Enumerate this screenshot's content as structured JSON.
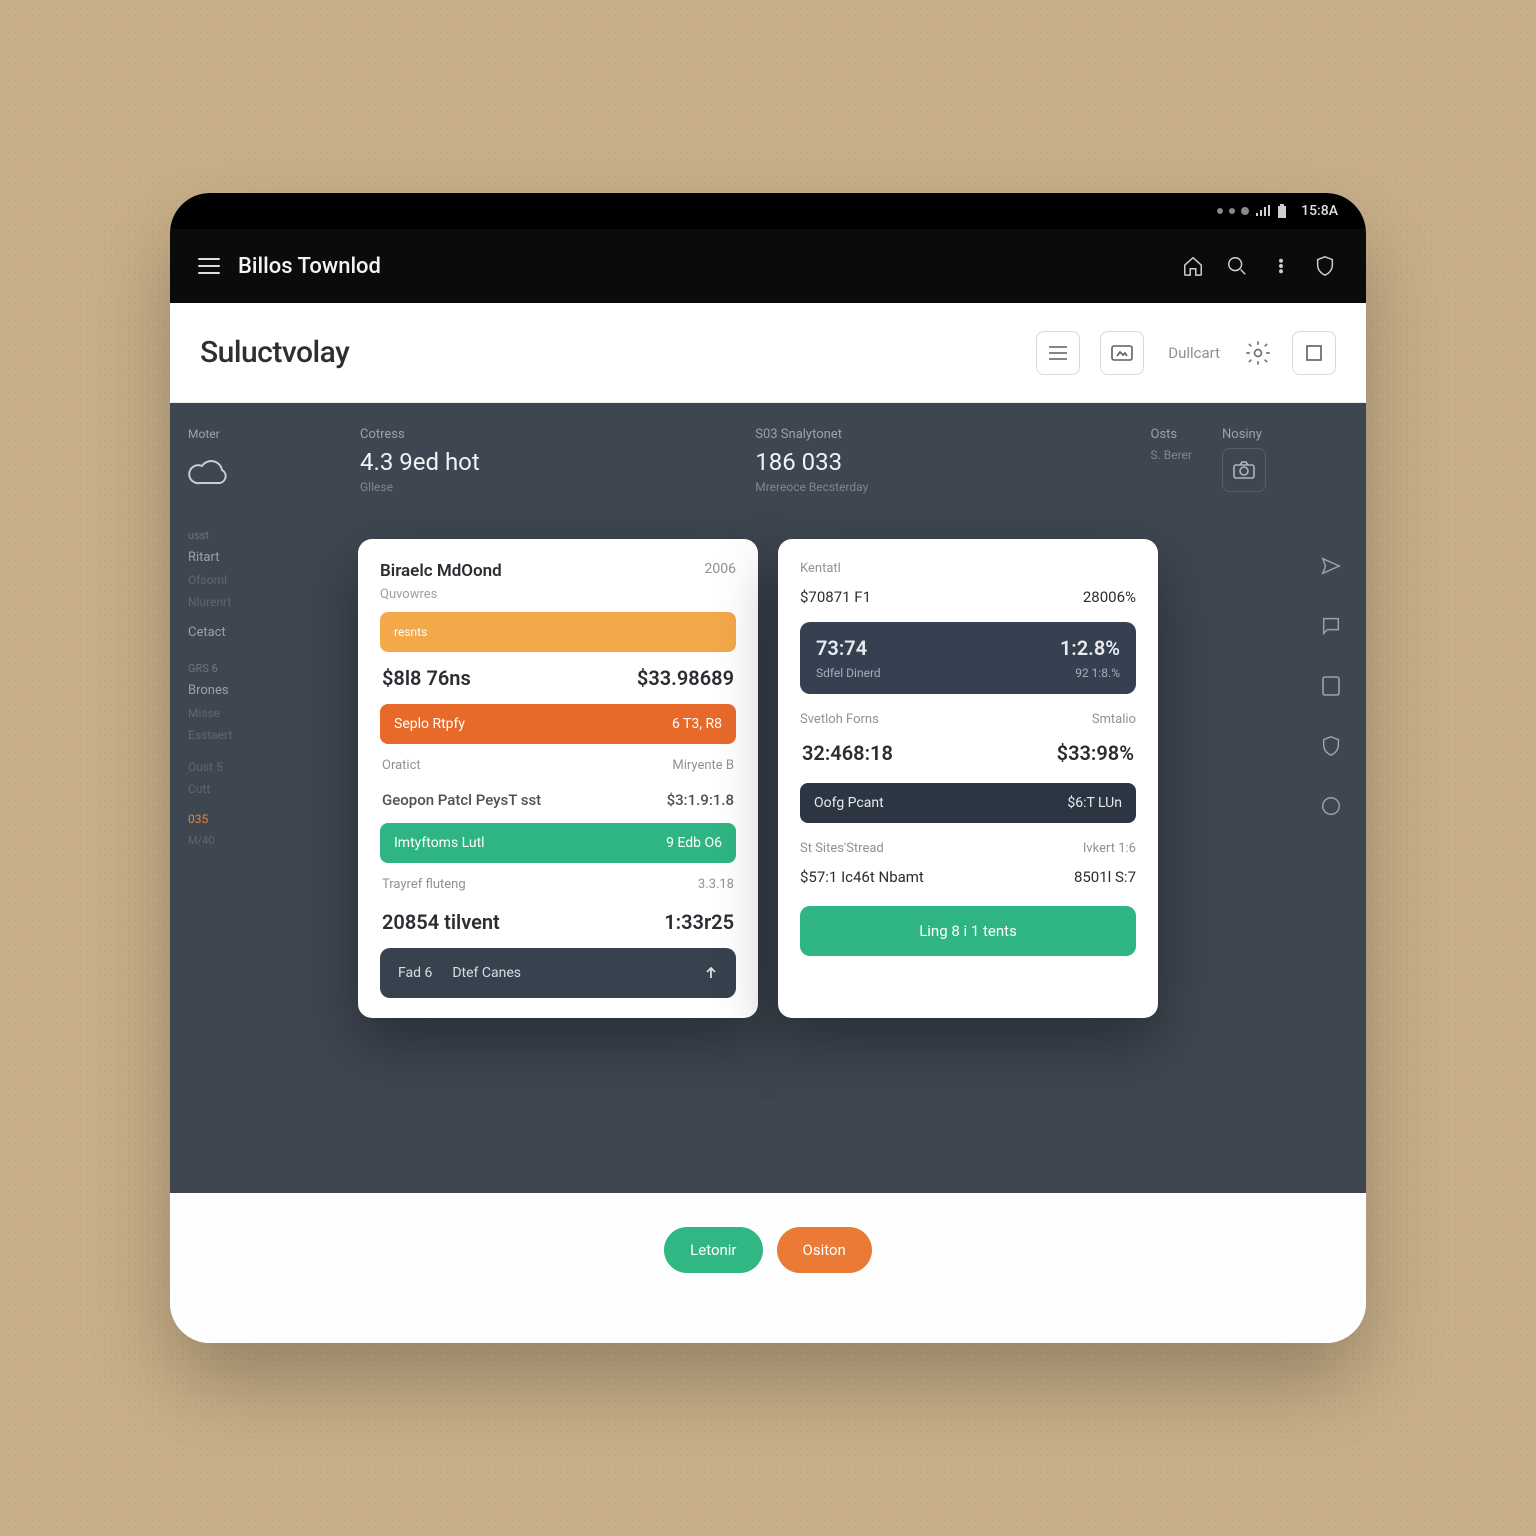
{
  "statusbar": {
    "time": "15:8A"
  },
  "topbar": {
    "title": "Billos Townlod"
  },
  "secondary": {
    "brand": "Suluctvolay",
    "dullcart_label": "Dullcart"
  },
  "dashboard": {
    "left_block": {
      "tag": "Cotress",
      "value": "4.3 9ed hot",
      "sub": "Gllese"
    },
    "mid_block": {
      "tag": "S03 Snalytonet",
      "value": "186 033",
      "sub": "Mrereoce Becsterday"
    },
    "right1": {
      "label": "Osts",
      "line2": "S. Berer"
    },
    "right2": {
      "label": "Nosiny"
    }
  },
  "sidebar": {
    "top_label": "Moter",
    "group1_head": "usst",
    "group1_item": "Ritart",
    "group1_sub1": "Ofsornl",
    "group1_sub2": "Nlurenrt",
    "group1_item2": "Cetact",
    "group2_head": "GRS 6",
    "group2_item": "Brones",
    "group2_sub1": "Misse",
    "group2_sub2": "Esstaert",
    "group3_sub1": "Oust 5",
    "group3_sub2": "Cutt",
    "accent": "035",
    "accent_sub": "M/40"
  },
  "card_left": {
    "title": "Biraelc MdOond",
    "subtitle": "Quvowres",
    "corner": "2006",
    "bar1_left": "resnts",
    "row1_left": "$8l8 76ns",
    "row1_right": "$33.98689",
    "bar2_left": "Seplo Rtpfy",
    "bar2_right": "6 T3,   R8",
    "row_small_left": "Oratict",
    "row_small_right": "Miryente B",
    "row2_left": "Geopon Patcl PeysT sst",
    "row2_right": "$3:1.9:1.8",
    "bar3_left": "Imtyftoms Lutl",
    "bar3_right": "9 Edb O6",
    "row3_left": "Trayref fluteng",
    "row3_right": "3.3.18",
    "row4_left": "20854 tilvent",
    "row4_right": "1:33r25",
    "footer_a": "Fad 6",
    "footer_b": "Dtef Canes"
  },
  "card_right": {
    "hdr_left": "Kentatl",
    "hdr_right": "",
    "val_left": "$70871 F1",
    "val_right": "28006%",
    "pill_top_left": "73:74",
    "pill_top_right": "1:2.8%",
    "pill_bot_left": "Sdfel Dinerd",
    "pill_bot_right": "92 1:8.%",
    "row1_hdr_left": "Svetloh Forns",
    "row1_hdr_right": "Smtalio",
    "row1_val_left": "32:468:18",
    "row1_val_right": "$33:98%",
    "dark_left": "Oofg Pcant",
    "dark_right": "$6:T LUn",
    "row2_hdr_left": "St Sites'Stread",
    "row2_hdr_right": "Ivkert 1:6",
    "row2_val_left": "$57:1 Ic46t Nbamt",
    "row2_val_right": "8501l S:7",
    "footer": "Ling 8 i 1 tents"
  },
  "bottom": {
    "pill_green": "Letonir",
    "pill_orange": "Ositon"
  }
}
